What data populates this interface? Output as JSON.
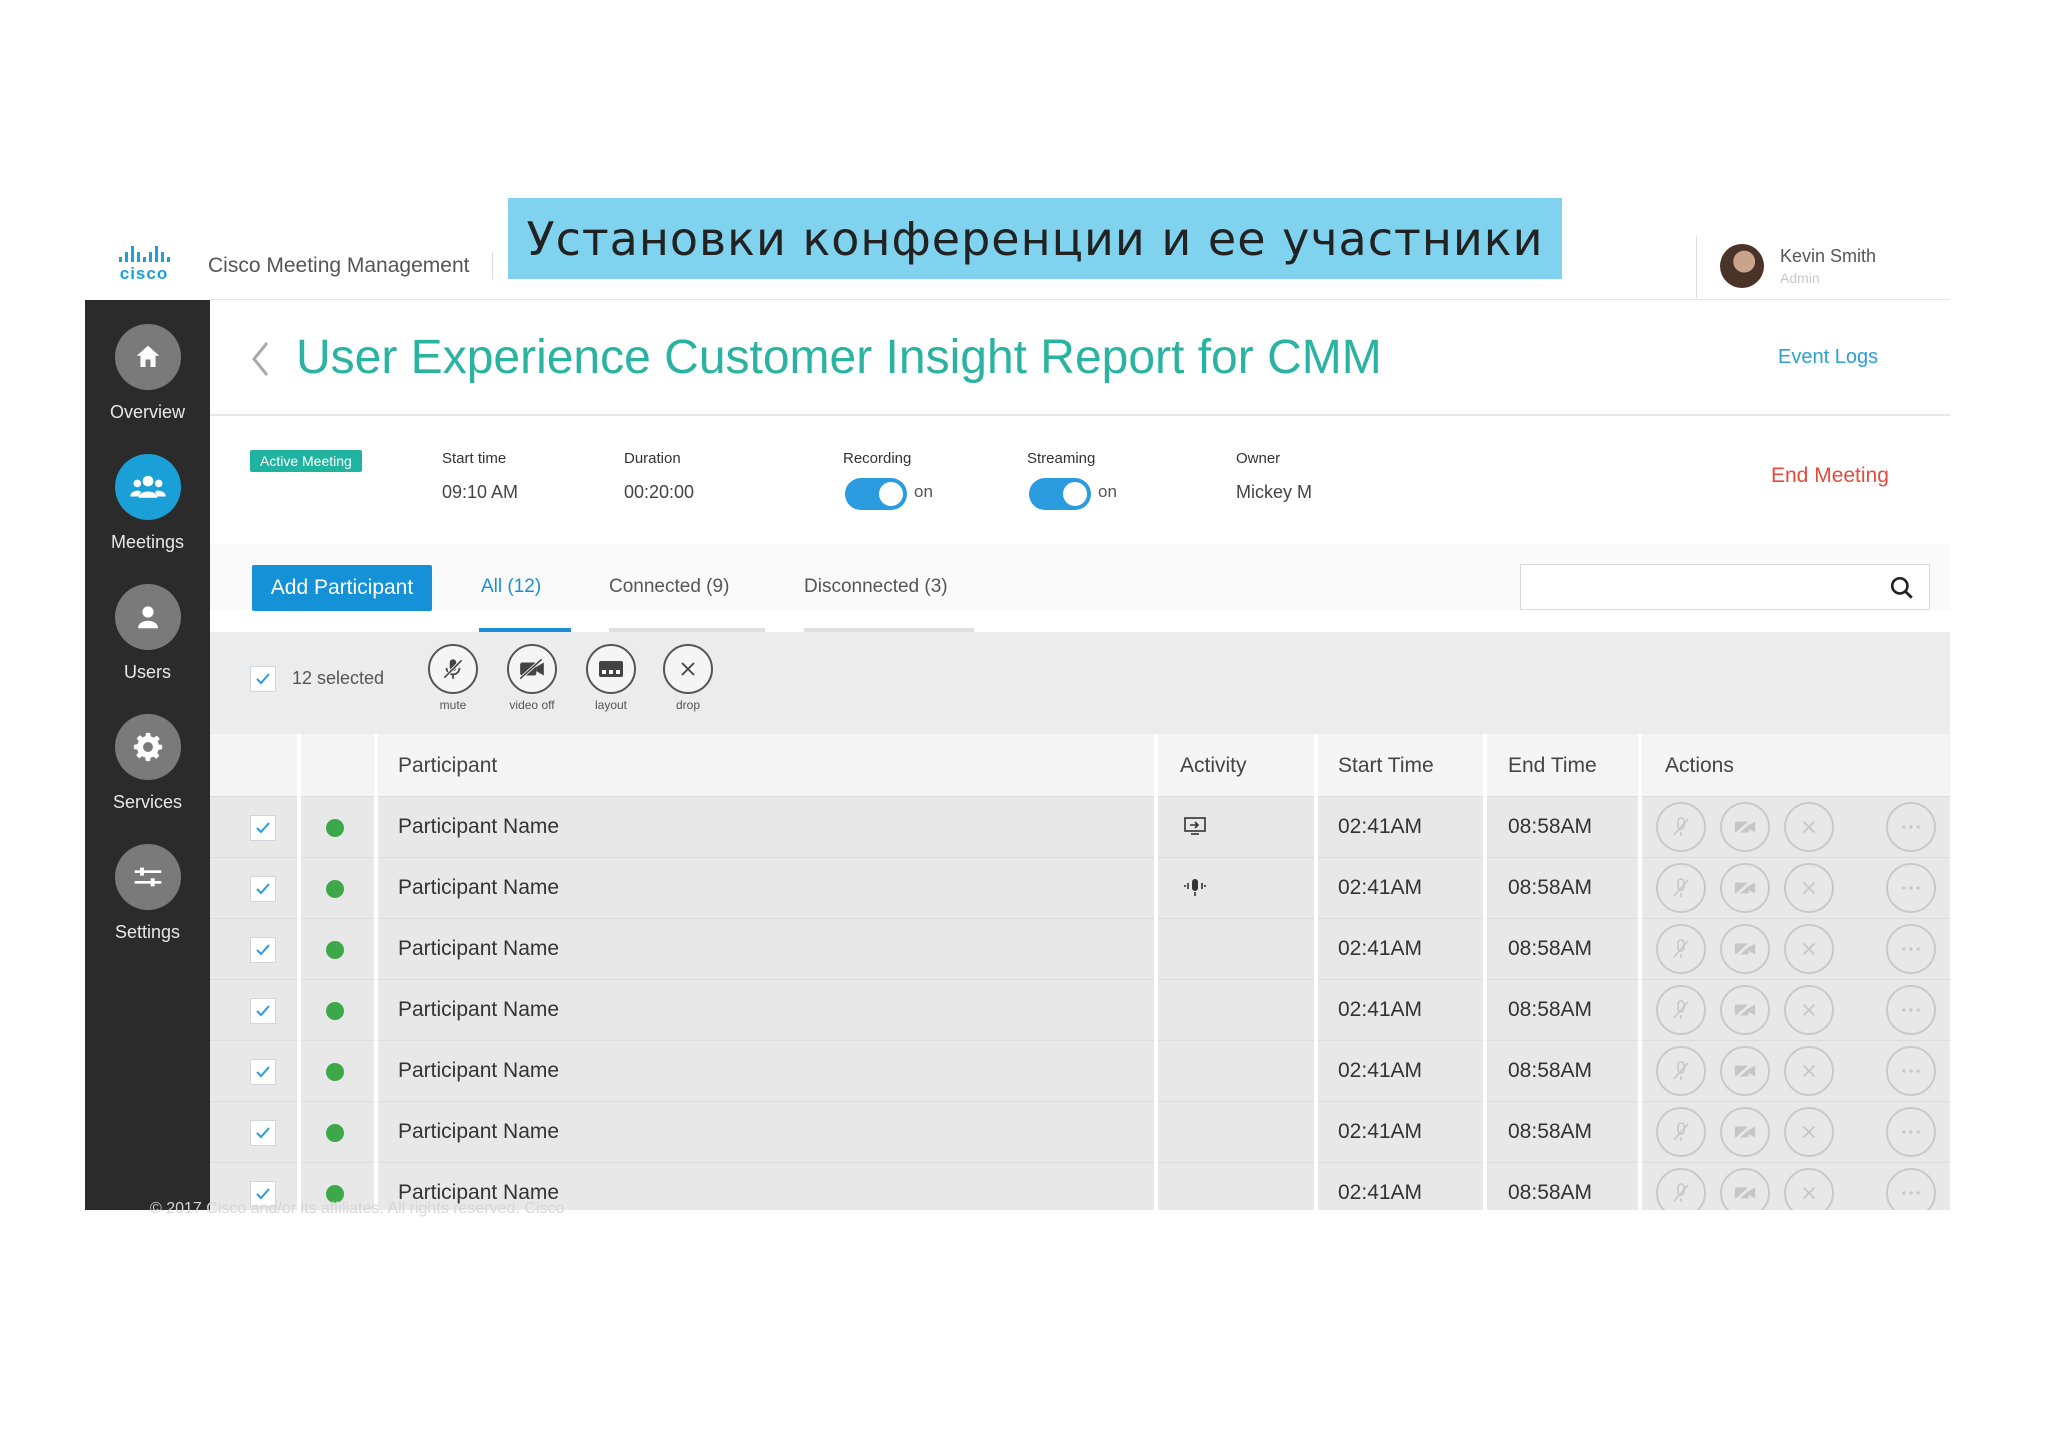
{
  "banner": "Установки конференции и ее участники",
  "header": {
    "logo_text": "cisco",
    "app_title": "Cisco Meeting Management",
    "user_name": "Kevin Smith",
    "user_role": "Admin"
  },
  "sidebar": {
    "items": [
      {
        "label": "Overview",
        "icon": "home-icon"
      },
      {
        "label": "Meetings",
        "icon": "meetings-icon",
        "active": true
      },
      {
        "label": "Users",
        "icon": "user-icon"
      },
      {
        "label": "Services",
        "icon": "gear-icon"
      },
      {
        "label": "Settings",
        "icon": "sliders-icon"
      }
    ]
  },
  "page": {
    "title": "User Experience Customer Insight Report for CMM",
    "event_logs": "Event Logs"
  },
  "meeting": {
    "status": "Active Meeting",
    "start_time_label": "Start time",
    "start_time": "09:10 AM",
    "duration_label": "Duration",
    "duration": "00:20:00",
    "recording_label": "Recording",
    "recording_state": "on",
    "streaming_label": "Streaming",
    "streaming_state": "on",
    "owner_label": "Owner",
    "owner": "Mickey M",
    "end_meeting": "End Meeting"
  },
  "toolbar": {
    "add_participant": "Add Participant",
    "tabs": [
      {
        "label": "All (12)",
        "active": true
      },
      {
        "label": "Connected (9)"
      },
      {
        "label": "Disconnected (3)"
      }
    ]
  },
  "bulk": {
    "selected": "12 selected",
    "actions": [
      {
        "label": "mute",
        "icon": "mic-off-icon"
      },
      {
        "label": "video off",
        "icon": "video-off-icon"
      },
      {
        "label": "layout",
        "icon": "layout-icon"
      },
      {
        "label": "drop",
        "icon": "close-icon"
      }
    ]
  },
  "table": {
    "columns": [
      "Participant",
      "Activity",
      "Start Time",
      "End Time",
      "Actions"
    ],
    "rows": [
      {
        "name": "Participant Name",
        "activity": "screen-share-icon",
        "start": "02:41AM",
        "end": "08:58AM"
      },
      {
        "name": "Participant Name",
        "activity": "speaking-icon",
        "start": "02:41AM",
        "end": "08:58AM"
      },
      {
        "name": "Participant Name",
        "activity": "",
        "start": "02:41AM",
        "end": "08:58AM"
      },
      {
        "name": "Participant Name",
        "activity": "",
        "start": "02:41AM",
        "end": "08:58AM"
      },
      {
        "name": "Participant Name",
        "activity": "",
        "start": "02:41AM",
        "end": "08:58AM"
      },
      {
        "name": "Participant Name",
        "activity": "",
        "start": "02:41AM",
        "end": "08:58AM"
      },
      {
        "name": "Participant Name",
        "activity": "",
        "start": "02:41AM",
        "end": "08:58AM"
      }
    ]
  },
  "footer": "© 2017  Cisco and/or its affiliates. All rights reserved.   Cisco",
  "colors": {
    "accent": "#1591d8",
    "title": "#2ab3a0",
    "end": "#e54a3c",
    "online": "#3ca84a"
  }
}
